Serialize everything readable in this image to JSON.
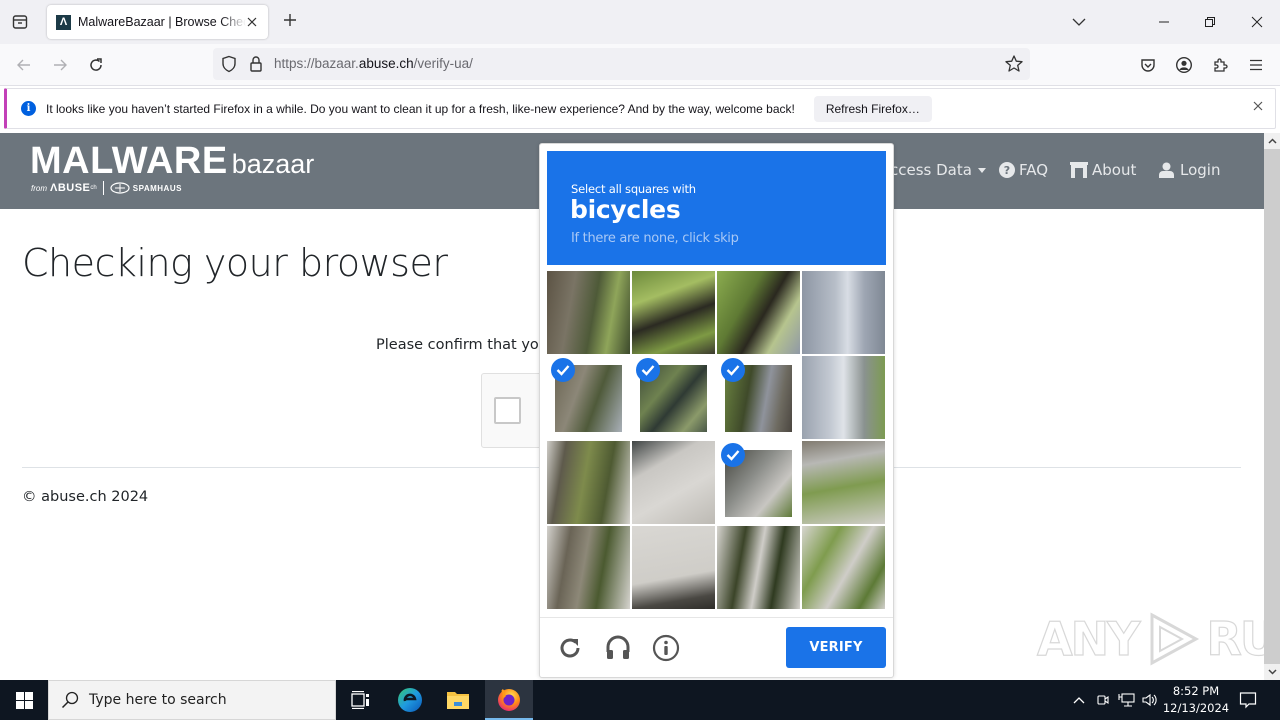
{
  "browser": {
    "tab": {
      "title": "MalwareBazaar | Browse Checking your browser",
      "favicon_letter": "Λ"
    },
    "url": {
      "prefix": "https://bazaar.",
      "host": "abuse.ch",
      "path": "/verify-ua/"
    },
    "notification": {
      "message": "It looks like you haven’t started Firefox in a while. Do you want to clean it up for a fresh, like-new experience? And by the way, welcome back!",
      "button_label": "Refresh Firefox…"
    }
  },
  "site": {
    "logo": {
      "main": "MALWARE",
      "secondary": "bazaar",
      "from": "from",
      "abuse": "ΛBUSE",
      "abuse_sup": "ch",
      "spamhaus": "SPAMHAUS"
    },
    "nav": [
      {
        "label": "Access Data",
        "icon": "dropdown-caret"
      },
      {
        "label": "FAQ",
        "icon": "question-circle-icon"
      },
      {
        "label": "About",
        "icon": "building-icon"
      },
      {
        "label": "Login",
        "icon": "user-icon"
      }
    ],
    "page_title": "Checking your browser",
    "confirm_text": "Please confirm that you are human",
    "copyright": "© abuse.ch 2024",
    "watermark": {
      "left": "ANY",
      "right": "RUN"
    }
  },
  "captcha": {
    "instruction": "Select all squares with",
    "target": "bicycles",
    "hint": "If there are none, click skip",
    "verify_label": "VERIFY",
    "tiles": [
      {
        "row": 0,
        "col": 0,
        "selected": false
      },
      {
        "row": 0,
        "col": 1,
        "selected": false
      },
      {
        "row": 0,
        "col": 2,
        "selected": false
      },
      {
        "row": 0,
        "col": 3,
        "selected": false
      },
      {
        "row": 1,
        "col": 0,
        "selected": true
      },
      {
        "row": 1,
        "col": 1,
        "selected": true
      },
      {
        "row": 1,
        "col": 2,
        "selected": true
      },
      {
        "row": 1,
        "col": 3,
        "selected": false
      },
      {
        "row": 2,
        "col": 0,
        "selected": false
      },
      {
        "row": 2,
        "col": 1,
        "selected": false
      },
      {
        "row": 2,
        "col": 2,
        "selected": true
      },
      {
        "row": 2,
        "col": 3,
        "selected": false
      },
      {
        "row": 3,
        "col": 0,
        "selected": false
      },
      {
        "row": 3,
        "col": 1,
        "selected": false
      },
      {
        "row": 3,
        "col": 2,
        "selected": false
      },
      {
        "row": 3,
        "col": 3,
        "selected": false
      }
    ],
    "colors": {
      "accent": "#1a73e8"
    }
  },
  "taskbar": {
    "search_placeholder": "Type here to search",
    "time": "8:52 PM",
    "date": "12/13/2024"
  }
}
